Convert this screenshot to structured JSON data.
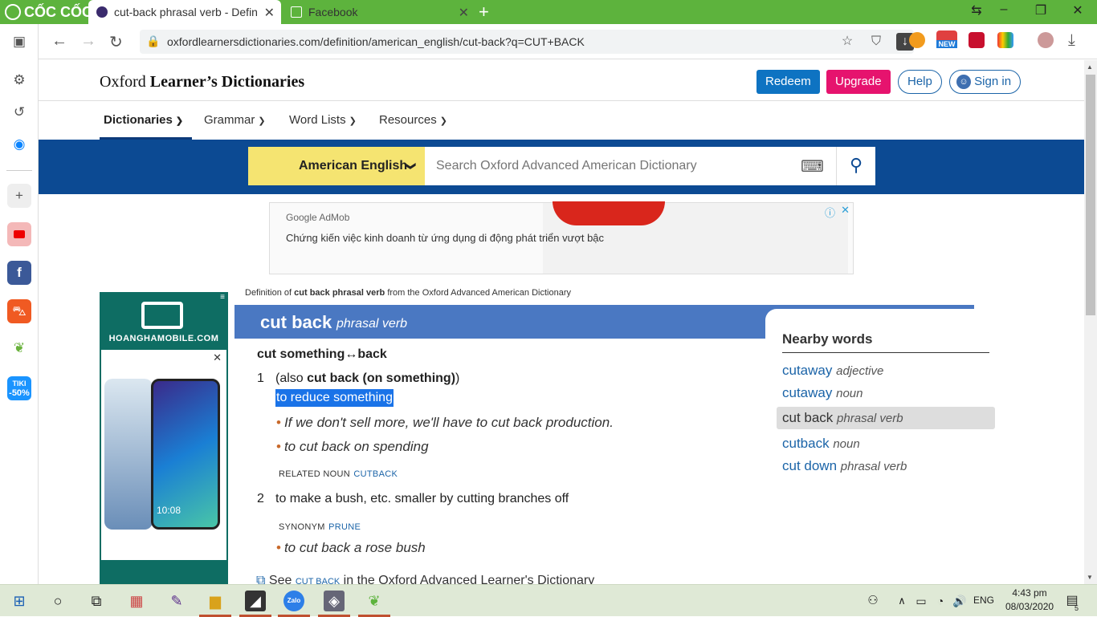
{
  "browser": {
    "brand": "CỐC CỐC",
    "tabs": [
      {
        "title": "cut-back phrasal verb - Defin",
        "active": true
      },
      {
        "title": "Facebook",
        "active": false
      }
    ],
    "url": "oxfordlearnersdictionaries.com/definition/american_english/cut-back?q=CUT+BACK",
    "new_badge": "NEW"
  },
  "sidebar": {
    "promo_top": "TIKI",
    "promo_bottom": "-50%"
  },
  "site": {
    "logo_regular": "Oxford",
    "logo_bold": "Learner’s Dictionaries",
    "buttons": {
      "redeem": "Redeem",
      "upgrade": "Upgrade",
      "help": "Help",
      "signin": "Sign in"
    },
    "menu": [
      "Dictionaries",
      "Grammar",
      "Word Lists",
      "Resources"
    ],
    "dict_select": "American English",
    "search_placeholder": "Search Oxford Advanced American Dictionary"
  },
  "ads": {
    "top": {
      "brand_google": "Google",
      "brand_admob": "AdMob",
      "text": "Chứng kiến việc kinh doanh từ ứng dụng di động phát triển vượt bậc"
    },
    "side": {
      "brand": "HOANGHAMOBILE.COM",
      "phone_time": "10:08"
    }
  },
  "entry": {
    "source_prefix": "Definition of ",
    "source_bold": "cut back phrasal verb",
    "source_suffix": " from the Oxford Advanced American Dictionary",
    "headword": "cut back",
    "pos": "phrasal verb",
    "pattern": "cut something↔back",
    "senses": [
      {
        "num": "1",
        "also_open": "(also ",
        "also_bold": "cut back (on something)",
        "also_close": ")",
        "definition": "to reduce something",
        "examples": [
          "If we don't sell more, we'll have to cut back production.",
          "to cut back on spending"
        ],
        "xref_label": "RELATED NOUN",
        "xref_link": "CUTBACK"
      },
      {
        "num": "2",
        "definition": "to make a bush, etc. smaller by cutting branches off",
        "xref_label": "SYNONYM",
        "xref_link": "PRUNE",
        "examples": [
          "to cut back a rose bush"
        ]
      }
    ],
    "see_prefix": "See ",
    "see_link": "CUT BACK",
    "see_suffix": " in the Oxford Advanced Learner's Dictionary"
  },
  "nearby": {
    "title": "Nearby words",
    "items": [
      {
        "word": "cutaway",
        "pos": "adjective",
        "selected": false
      },
      {
        "word": "cutaway",
        "pos": "noun",
        "selected": false
      },
      {
        "word": "cut back",
        "pos": "phrasal verb",
        "selected": true
      },
      {
        "word": "cutback",
        "pos": "noun",
        "selected": false
      },
      {
        "word": "cut down",
        "pos": "phrasal verb",
        "selected": false
      }
    ]
  },
  "taskbar": {
    "zalo": "Zalo",
    "lang": "ENG",
    "time": "4:43 pm",
    "date": "08/03/2020",
    "notif_count": "5"
  }
}
